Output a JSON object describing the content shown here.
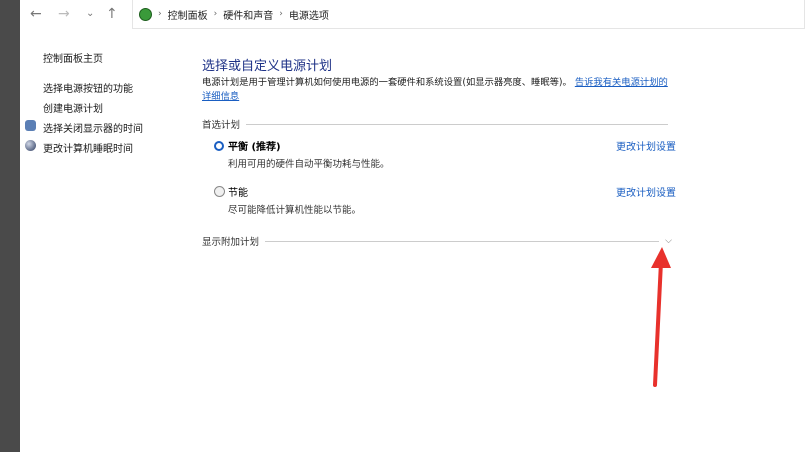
{
  "nav": {
    "back": "←",
    "forward": "→",
    "recent": "⌄",
    "up": "↑"
  },
  "breadcrumb": [
    "控制面板",
    "硬件和声音",
    "电源选项"
  ],
  "sidebar": {
    "home": "控制面板主页",
    "items": [
      "选择电源按钮的功能",
      "创建电源计划",
      "选择关闭显示器的时间",
      "更改计算机睡眠时间"
    ]
  },
  "main": {
    "title": "选择或自定义电源计划",
    "description": "电源计划是用于管理计算机如何使用电源的一套硬件和系统设置(如显示器亮度、睡眠等)。",
    "learn_more": "告诉我有关电源计划的详细信息",
    "preferred_label": "首选计划",
    "plans": [
      {
        "name": "平衡 (推荐)",
        "desc": "利用可用的硬件自动平衡功耗与性能。",
        "link": "更改计划设置",
        "selected": true
      },
      {
        "name": "节能",
        "desc": "尽可能降低计算机性能以节能。",
        "link": "更改计划设置",
        "selected": false
      }
    ],
    "additional_label": "显示附加计划"
  },
  "colors": {
    "accent": "#1a5ec2",
    "title": "#1e3287",
    "arrow": "#e8312c"
  }
}
